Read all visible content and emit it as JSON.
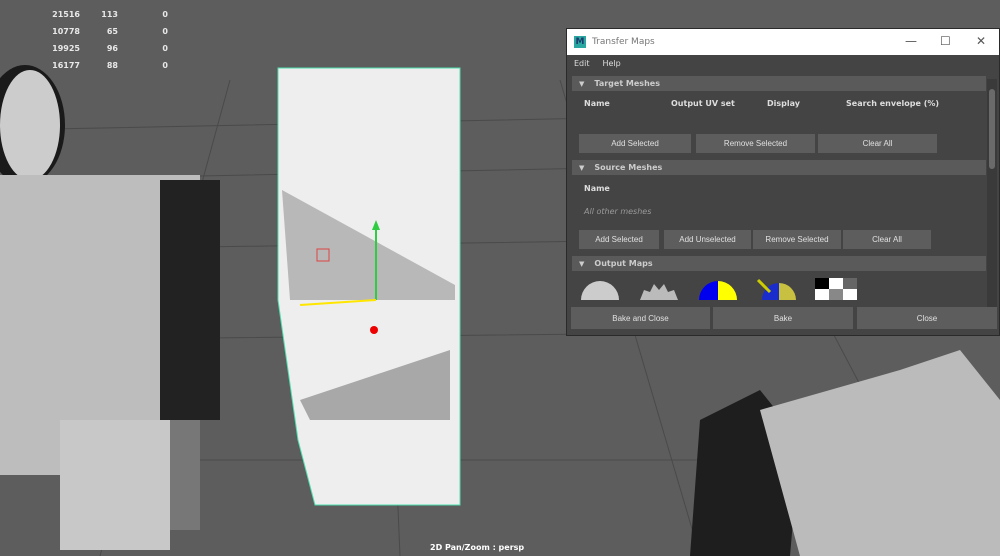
{
  "hud": {
    "rows": [
      [
        "21516",
        "113",
        "0"
      ],
      [
        "10778",
        "65",
        "0"
      ],
      [
        "19925",
        "96",
        "0"
      ],
      [
        "16177",
        "88",
        "0"
      ]
    ]
  },
  "viewport": {
    "camera_label": "2D Pan/Zoom : persp"
  },
  "window": {
    "title": "Transfer Maps",
    "menu": [
      "Edit",
      "Help"
    ],
    "target": {
      "header": "Target Meshes",
      "columns": [
        "Name",
        "Output UV set",
        "Display",
        "Search envelope (%)"
      ],
      "buttons": [
        "Add Selected",
        "Remove Selected",
        "Clear All"
      ]
    },
    "source": {
      "header": "Source Meshes",
      "column": "Name",
      "placeholder": "All other meshes",
      "buttons": [
        "Add Selected",
        "Add Unselected",
        "Remove Selected",
        "Clear All"
      ]
    },
    "output": {
      "header": "Output Maps",
      "maps": [
        "normal-map-icon",
        "displacement-map-icon",
        "diffuse-map-icon",
        "ambient-occlusion-map-icon",
        "checker-map-icon"
      ]
    },
    "footer": [
      "Bake and Close",
      "Bake",
      "Close"
    ]
  },
  "colors": {
    "panel": "#444444",
    "section": "#5a5a5a",
    "button": "#5d5d5d",
    "wireframe": "#4de0b0"
  }
}
